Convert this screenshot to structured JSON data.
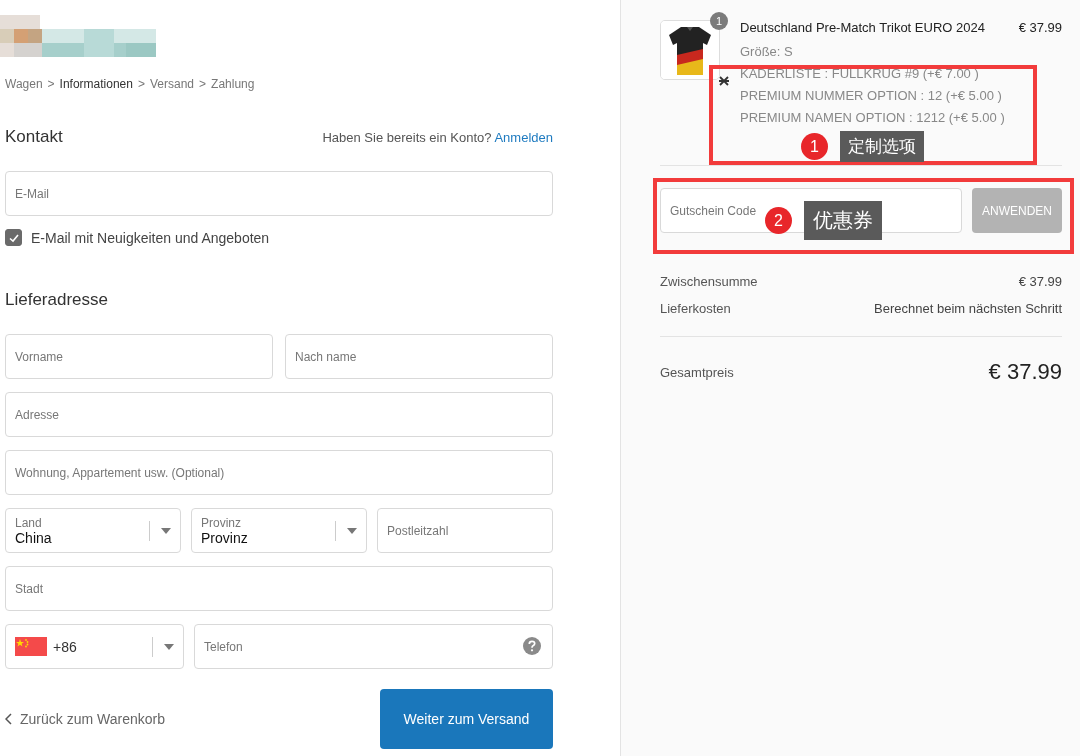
{
  "breadcrumb": [
    {
      "kind": "step",
      "label": "Wagen",
      "selected": false
    },
    {
      "kind": "separator",
      "label": ">"
    },
    {
      "kind": "step",
      "label": "Informationen",
      "selected": true
    },
    {
      "kind": "separator",
      "label": ">"
    },
    {
      "kind": "step",
      "label": "Versand",
      "selected": false
    },
    {
      "kind": "separator",
      "label": ">"
    },
    {
      "kind": "step",
      "label": "Zahlung",
      "selected": false
    }
  ],
  "contact": {
    "title": "Kontakt",
    "account_prompt": "Haben Sie bereits ein Konto?",
    "login_link": "Anmelden",
    "email": {
      "placeholder": "E-Mail"
    },
    "newsletter": {
      "label": "E-Mail mit Neuigkeiten und Angeboten",
      "checked": true
    }
  },
  "shipping": {
    "title": "Lieferadresse",
    "rows": [
      [
        {
          "kind": "text",
          "placeholder": "Vorname"
        },
        {
          "kind": "text",
          "placeholder": "Nach name"
        }
      ],
      [
        {
          "kind": "text",
          "placeholder": "Adresse"
        }
      ],
      [
        {
          "kind": "text",
          "placeholder": "Wohnung, Appartement usw. (Optional)"
        }
      ],
      [
        {
          "kind": "select",
          "label": "Land",
          "value": "China"
        },
        {
          "kind": "select",
          "label": "Provinz",
          "value": "Provinz"
        },
        {
          "kind": "text",
          "placeholder": "Postleitzahl"
        }
      ],
      [
        {
          "kind": "text",
          "placeholder": "Stadt"
        }
      ],
      [
        {
          "kind": "phone_code",
          "value": "+86"
        },
        {
          "kind": "phone",
          "placeholder": "Telefon"
        }
      ]
    ]
  },
  "actions": {
    "back_link": "Zurück zum Warenkorb",
    "continue_button": "Weiter zum Versand"
  },
  "summary": {
    "item": {
      "quantity": "1",
      "name": "Deutschland Pre-Match Trikot EURO 2024",
      "price": "€ 37.99",
      "size": "Größe: S",
      "options": [
        "KADERLISTE : FULLKRUG #9 (+€ 7.00 )",
        "PREMIUM NUMMER OPTION : 12 (+€ 5.00 )",
        "PREMIUM NAMEN OPTION : 1212 (+€ 5.00 )"
      ]
    },
    "coupon": {
      "placeholder": "Gutschein Code",
      "button": "ANWENDEN",
      "disabled": true
    },
    "lines": [
      {
        "label": "Zwischensumme",
        "value": "€ 37.99"
      },
      {
        "label": "Lieferkosten",
        "value": "Berechnet beim nächsten Schritt"
      }
    ],
    "total": {
      "label": "Gesamtpreis",
      "value": "€ 37.99"
    }
  },
  "annotations": [
    {
      "number": "1",
      "label": "定制选项"
    },
    {
      "number": "2",
      "label": "优惠券"
    }
  ]
}
